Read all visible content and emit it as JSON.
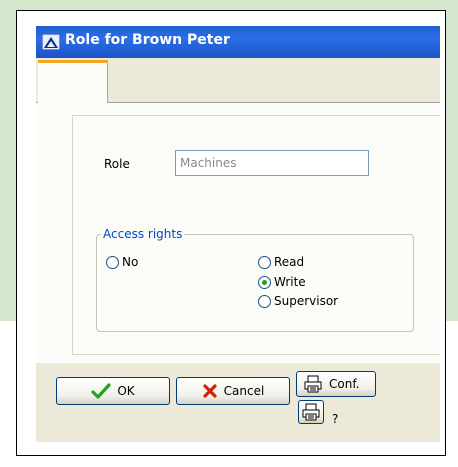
{
  "window": {
    "title": "Role for Brown Peter",
    "icon": "role-window-icon"
  },
  "tabs": [
    {
      "label": ""
    }
  ],
  "form": {
    "role_label": "Role",
    "role_value": "Machines",
    "access_rights": {
      "legend": "Access rights",
      "options": [
        {
          "label": "No",
          "checked": false
        },
        {
          "label": "Read",
          "checked": false
        },
        {
          "label": "Write",
          "checked": true
        },
        {
          "label": "Supervisor",
          "checked": false
        }
      ]
    }
  },
  "buttons": {
    "ok_label": "OK",
    "cancel_label": "Cancel",
    "conf_label": "Conf.",
    "help_label": "?"
  },
  "colors": {
    "titlebar": "#2a6ee8",
    "window_bg": "#ece9d8",
    "panel_bg": "#fbfbf8",
    "page_green": "#d5e6cc",
    "legend_blue": "#0046d5",
    "ok_check": "#22a020",
    "cancel_x": "#d81e05",
    "tab_accent": "#f5a623"
  }
}
